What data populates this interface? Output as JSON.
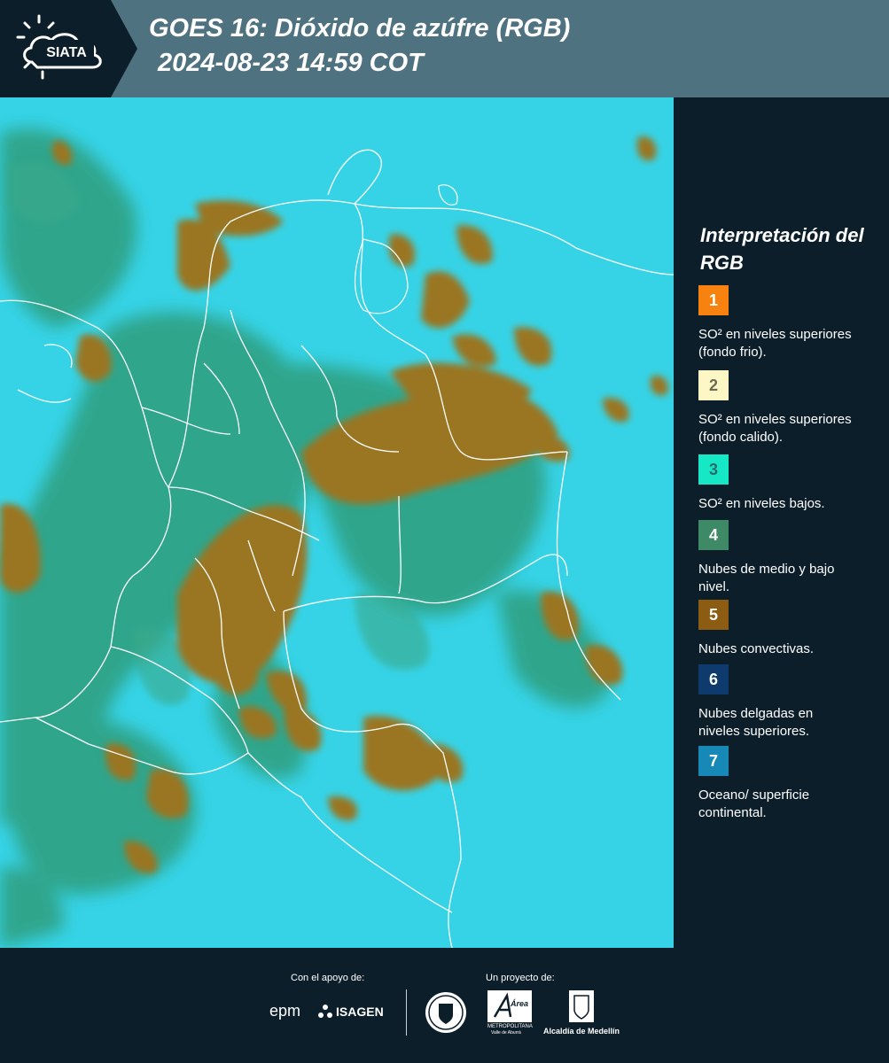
{
  "header": {
    "logo_text": "SIATA",
    "title_line1": "GOES 16: Dióxido de azúfre (RGB)",
    "title_line2": "2024-08-23 14:59 COT"
  },
  "legend": {
    "title": "Interpretación del RGB",
    "items": [
      {
        "number": "1",
        "color": "#f7820f",
        "number_color": "#ffffff",
        "description": "SO² en niveles superiores (fondo frio)."
      },
      {
        "number": "2",
        "color": "#fdf7c6",
        "number_color": "#6b6a50",
        "description": "SO² en niveles superiores (fondo calido)."
      },
      {
        "number": "3",
        "color": "#16e8c6",
        "number_color": "#2a6b6b",
        "description": "SO² en niveles bajos."
      },
      {
        "number": "4",
        "color": "#3f8a66",
        "number_color": "#ffffff",
        "description": "Nubes de medio y bajo nivel."
      },
      {
        "number": "5",
        "color": "#8c5c12",
        "number_color": "#ffffff",
        "description": "Nubes convectivas."
      },
      {
        "number": "6",
        "color": "#0e3a6e",
        "number_color": "#ffffff",
        "description": "Nubes delgadas en niveles superiores."
      },
      {
        "number": "7",
        "color": "#1689b6",
        "number_color": "#ffffff",
        "description": "Oceano/ superficie continental."
      }
    ]
  },
  "footer": {
    "support_label": "Con el apoyo de:",
    "project_label": "Un proyecto de:",
    "sponsors": {
      "epm": "epm",
      "isagen": "ISAGEN",
      "area_metropolitana": "Área",
      "area_subtitle": "METROPOLITANA",
      "area_subtitle2": "Valle de Aburrá",
      "alcaldia": "Alcaldía de Medellín"
    }
  },
  "map_colors": {
    "sea": "#36d3e6",
    "land_clouds": "#2f9e7d",
    "convective": "#9a7624",
    "borders": "#ffffff"
  }
}
